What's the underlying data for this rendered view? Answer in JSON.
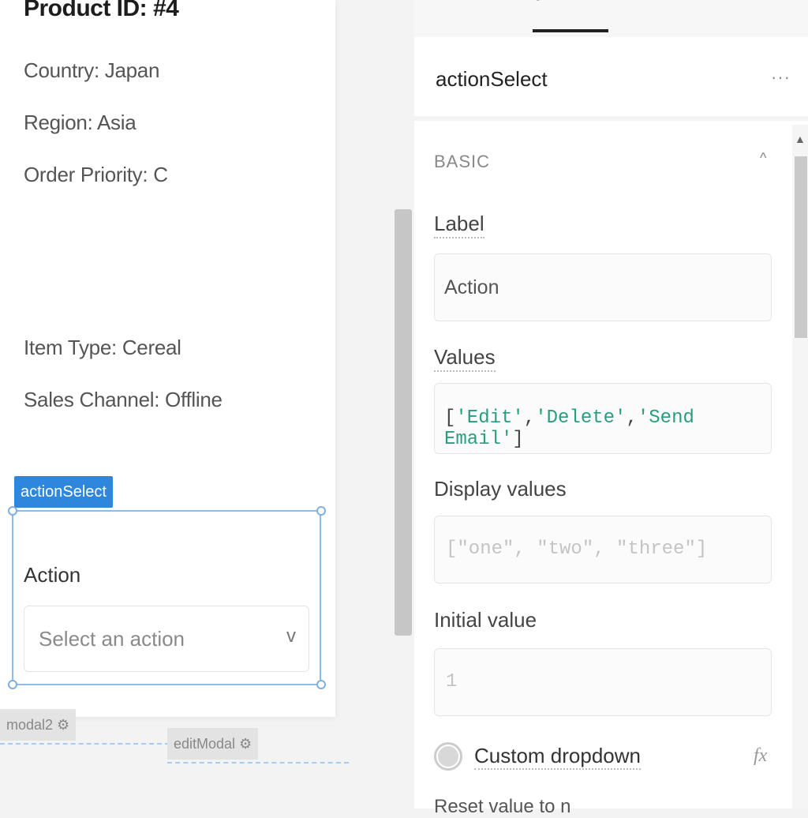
{
  "canvas": {
    "product_id": "Product ID: #4",
    "fields": {
      "country": "Country: Japan",
      "region": "Region: Asia",
      "order_priority": "Order Priority: C",
      "item_type": "Item Type: Cereal",
      "sales_channel": "Sales Channel: Offline"
    },
    "selected_component_tag": "actionSelect",
    "select_widget": {
      "label": "Action",
      "placeholder": "Select an action",
      "chevron": "v"
    },
    "modal_tags": [
      "modal2 ⚙",
      "editModal ⚙"
    ]
  },
  "panel": {
    "component_name": "actionSelect",
    "more_icon": "···",
    "section": "BASIC",
    "properties": {
      "label": {
        "title": "Label",
        "value": "Action"
      },
      "values": {
        "title": "Values",
        "open": "[",
        "items": [
          "'Edit'",
          "'Delete'",
          "'Send Email'"
        ],
        "close": "]"
      },
      "display_values": {
        "title": "Display values",
        "placeholder": "[\"one\", \"two\", \"three\"]"
      },
      "initial_value": {
        "title": "Initial value",
        "placeholder": "1"
      },
      "custom_dropdown": {
        "title": "Custom dropdown",
        "enabled": false,
        "fx": "fx"
      },
      "next_label": "Reset value to n"
    }
  },
  "colors": {
    "selection_blue": "#2f86dd",
    "code_green": "#2a9d7f"
  }
}
